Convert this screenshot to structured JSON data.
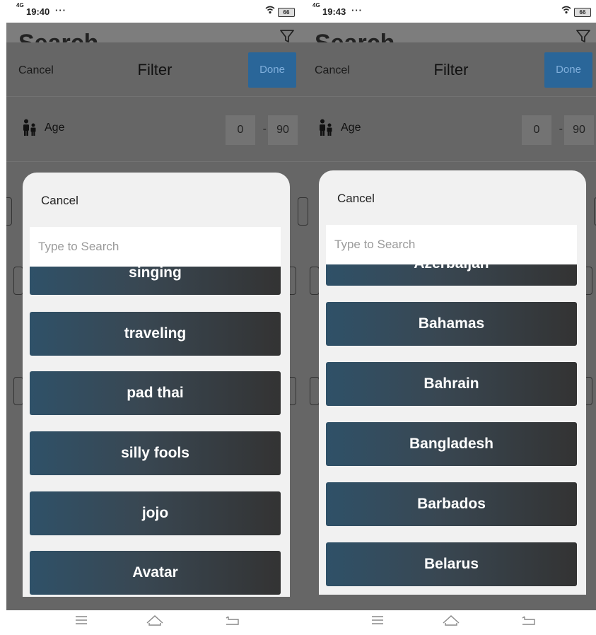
{
  "screens": [
    {
      "status": {
        "network": "4G",
        "time": "19:40",
        "dots": "···",
        "battery": "66"
      },
      "page_title": "Search",
      "filter": {
        "cancel_label": "Cancel",
        "title": "Filter",
        "done_label": "Done"
      },
      "age": {
        "label": "Age",
        "min": "0",
        "separator": "-",
        "max": "90"
      },
      "picker": {
        "cancel_label": "Cancel",
        "search_placeholder": "Type to Search",
        "options": [
          "singing",
          "traveling",
          "pad thai",
          "silly fools",
          "jojo",
          "Avatar"
        ]
      }
    },
    {
      "status": {
        "network": "4G",
        "time": "19:43",
        "dots": "···",
        "battery": "66"
      },
      "page_title": "Search",
      "filter": {
        "cancel_label": "Cancel",
        "title": "Filter",
        "done_label": "Done"
      },
      "age": {
        "label": "Age",
        "min": "0",
        "separator": "-",
        "max": "90"
      },
      "picker": {
        "cancel_label": "Cancel",
        "search_placeholder": "Type to Search",
        "options": [
          "Azerbaijan",
          "Bahamas",
          "Bahrain",
          "Bangladesh",
          "Barbados",
          "Belarus"
        ]
      }
    }
  ],
  "colors": {
    "done_button": "#2a6699",
    "dim_overlay": "#666666",
    "modal_bg": "#f1f1f1",
    "option_gradient_start": "#2f5168",
    "option_gradient_end": "#333333"
  },
  "icons": {
    "filter": "funnel-icon",
    "age": "people-icon",
    "wifi": "wifi-icon",
    "menu": "menu-icon",
    "home": "home-icon",
    "back": "back-icon"
  }
}
